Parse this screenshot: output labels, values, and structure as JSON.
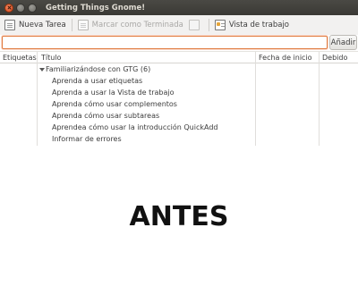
{
  "window": {
    "title": "Getting Things Gnome!"
  },
  "toolbar": {
    "new_task": "Nueva Tarea",
    "mark_done": "Marcar como Terminada",
    "work_view": "Vista de trabajo"
  },
  "quickadd": {
    "value": "",
    "add_label": "Añadir"
  },
  "columns": {
    "tags": "Etiquetas",
    "title": "Título",
    "start_date": "Fecha de inicio",
    "due": "Debido"
  },
  "tasks": {
    "parent": "Familiarizándose con GTG (6)",
    "children": [
      "Aprenda a usar etiquetas",
      "Aprenda a usar la Vista de trabajo",
      "Aprenda cómo usar complementos",
      "Aprenda cómo usar subtareas",
      "Aprendea cómo usar la introducción QuickAdd",
      "Informar de errores"
    ]
  },
  "overlay": {
    "text": "ANTES"
  },
  "colors": {
    "titlebar": "#3c3b37",
    "focus_border": "#e07a3e"
  }
}
